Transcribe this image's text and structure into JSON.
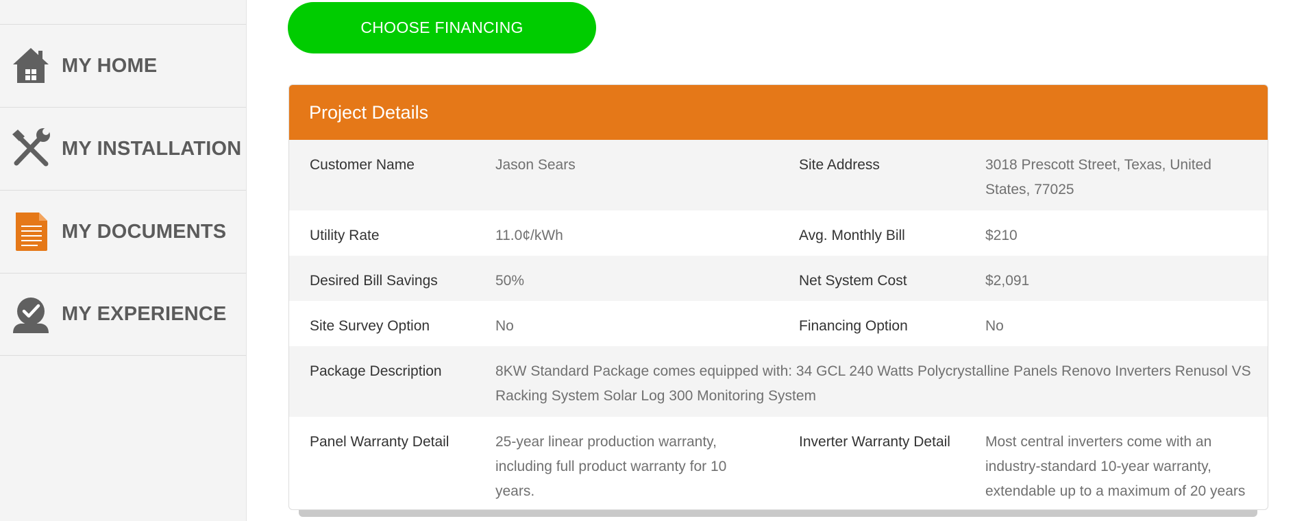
{
  "sidebar": {
    "items": [
      {
        "label": "MY HOME",
        "icon": "home-icon"
      },
      {
        "label": "MY INSTALLATION",
        "icon": "tools-icon"
      },
      {
        "label": "MY DOCUMENTS",
        "icon": "document-icon"
      },
      {
        "label": "MY EXPERIENCE",
        "icon": "experience-icon"
      }
    ]
  },
  "cta": {
    "label": "CHOOSE FINANCING",
    "color": "#00cc00"
  },
  "colors": {
    "accent": "#e57818",
    "sidebar_text": "#5b5b5b"
  },
  "project": {
    "title": "Project Details",
    "rows": [
      {
        "l1": "Customer Name",
        "v1": "Jason Sears",
        "l2": "Site Address",
        "v2": "3018 Prescott Street, Texas, United States, 77025"
      },
      {
        "l1": "Utility Rate",
        "v1": "11.0¢/kWh",
        "l2": "Avg. Monthly Bill",
        "v2": "$210"
      },
      {
        "l1": "Desired Bill Savings",
        "v1": "50%",
        "l2": "Net System Cost",
        "v2": "$2,091"
      },
      {
        "l1": "Site Survey Option",
        "v1": "No",
        "l2": "Financing Option",
        "v2": "No"
      },
      {
        "l1": "Package Description",
        "v1": "8KW Standard Package comes equipped with: 34 GCL 240 Watts Polycrystalline Panels Renovo Inverters Renusol VS Racking System Solar Log 300 Monitoring System"
      },
      {
        "l1": "Panel Warranty Detail",
        "v1": "25-year linear production warranty, including full product warranty for 10 years.",
        "l2": "Inverter Warranty Detail",
        "v2": "Most central inverters come with an industry-standard 10-year warranty, extendable up to a maximum of 20 years"
      }
    ]
  }
}
